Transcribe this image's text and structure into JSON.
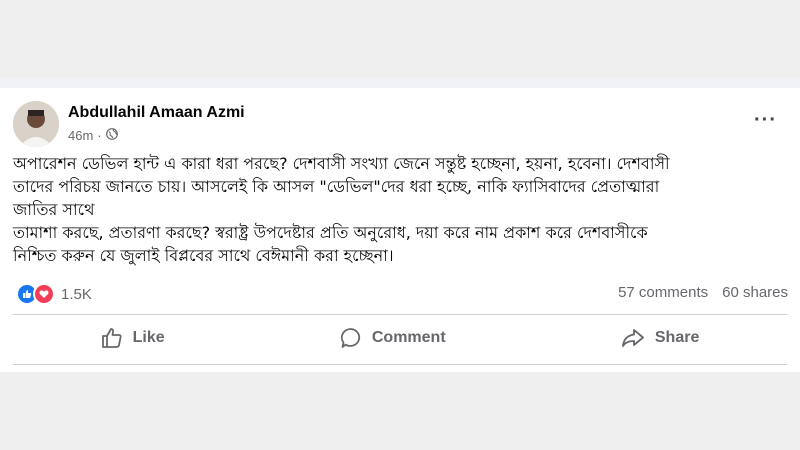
{
  "post": {
    "author": "Abdullahil Amaan Azmi",
    "time": "46m",
    "audience_icon": "globe-icon",
    "text_lines": [
      "অপারেশন ডেভিল হান্ট এ কারা ধরা পরছে? দেশবাসী সংখ্যা জেনে সন্তুষ্ট হচ্ছেনা, হয়না, হবেনা। দেশবাসী",
      "তাদের পরিচয় জানতে চায়। আসলেই কি আসল \"ডেভিল\"দের ধরা হচ্ছে,  নাকি ফ্যাসিবাদের প্রেতাত্মারা",
      "জাতির সাথে",
      "তামাশা করছে, প্রতারণা করছে? স্বরাষ্ট্র উপদেষ্টার প্রতি অনুরোধ, দয়া করে নাম প্রকাশ করে দেশবাসীকে",
      "নিশ্চিত করুন যে জুলাই বিপ্লবের সাথে বেঈমানী করা হচ্ছেনা।"
    ],
    "reactions_count": "1.5K",
    "comments": "57 comments",
    "shares": "60 shares"
  },
  "actions": {
    "like": "Like",
    "comment": "Comment",
    "share": "Share"
  },
  "colors": {
    "like_blue": "#1877f2",
    "love_red": "#f33e58",
    "secondary_text": "#65676b"
  }
}
